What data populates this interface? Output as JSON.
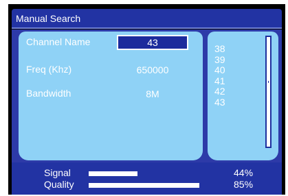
{
  "window": {
    "title": "Manual Search"
  },
  "form": {
    "channel_name_label": "Channel Name",
    "channel_name_value": "43",
    "freq_label": "Freq (Khz)",
    "freq_value": "650000",
    "bandwidth_label": "Bandwidth",
    "bandwidth_value": "8M"
  },
  "channel_list": [
    "38",
    "39",
    "40",
    "41",
    "42",
    "43"
  ],
  "meters": {
    "signal_label": "Signal",
    "signal_value": 0.44,
    "signal_text": "44%",
    "quality_label": "Quality",
    "quality_value": 0.85,
    "quality_text": "85%"
  },
  "colors": {
    "background": "#000000",
    "title_bar": "#2233a3",
    "panel": "#8fd2f6",
    "selected_field": "#1c2b9c",
    "text": "#ffffff"
  },
  "icons": {
    "scrollbar": "vertical-scrollbar"
  }
}
